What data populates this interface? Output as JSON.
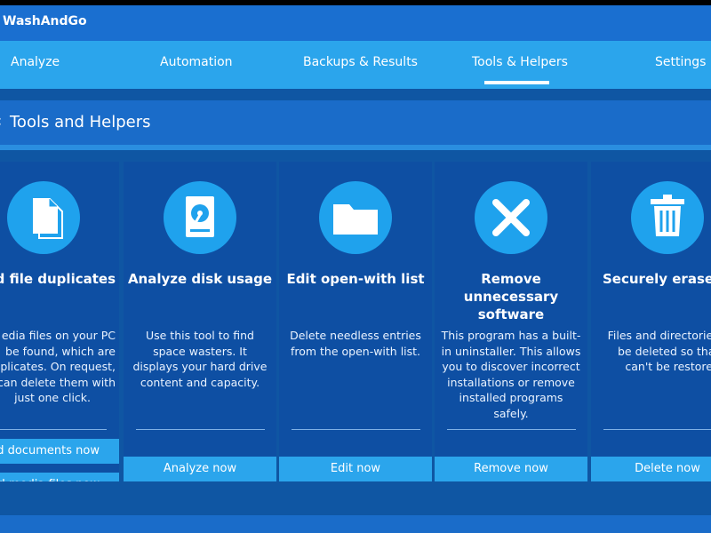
{
  "app": {
    "title": "WashAndGo"
  },
  "nav": {
    "tabs": [
      {
        "label": "Analyze"
      },
      {
        "label": "Automation"
      },
      {
        "label": "Backups & Results"
      },
      {
        "label": "Tools & Helpers"
      },
      {
        "label": "Settings"
      }
    ],
    "active_tab": "Tools & Helpers"
  },
  "section": {
    "title": "Tools and Helpers"
  },
  "cards": [
    {
      "icon": "documents-icon",
      "title": "d file duplicates",
      "desc_lines": [
        "edia files on your PC",
        "be found, which are",
        "plicates. On request,",
        "can delete them with",
        "just one click."
      ],
      "buttons": [
        "nd documents now",
        "nd media files now"
      ]
    },
    {
      "icon": "hard-disk-icon",
      "title": "Analyze disk usage",
      "desc": "Use this tool to find space wasters. It displays your hard drive content and capacity.",
      "button": "Analyze now"
    },
    {
      "icon": "folder-icon",
      "title": "Edit open-with list",
      "desc": "Delete needless entries from the open-with list.",
      "button": "Edit now"
    },
    {
      "icon": "close-x-icon",
      "title": "Remove unnecessary software",
      "desc": "This program has a built-in uninstaller. This allows you to discover incorrect installations or remove installed programs safely.",
      "button": "Remove now"
    },
    {
      "icon": "trash-icon",
      "title": "Securely erase fi",
      "desc_lines": [
        "Files and directories",
        "be deleted so that t",
        "can't be restored"
      ],
      "button": "Delete now"
    }
  ],
  "colors": {
    "accent": "#2ba5ec",
    "panel": "#0e4fa3",
    "background": "#0f56a3"
  }
}
